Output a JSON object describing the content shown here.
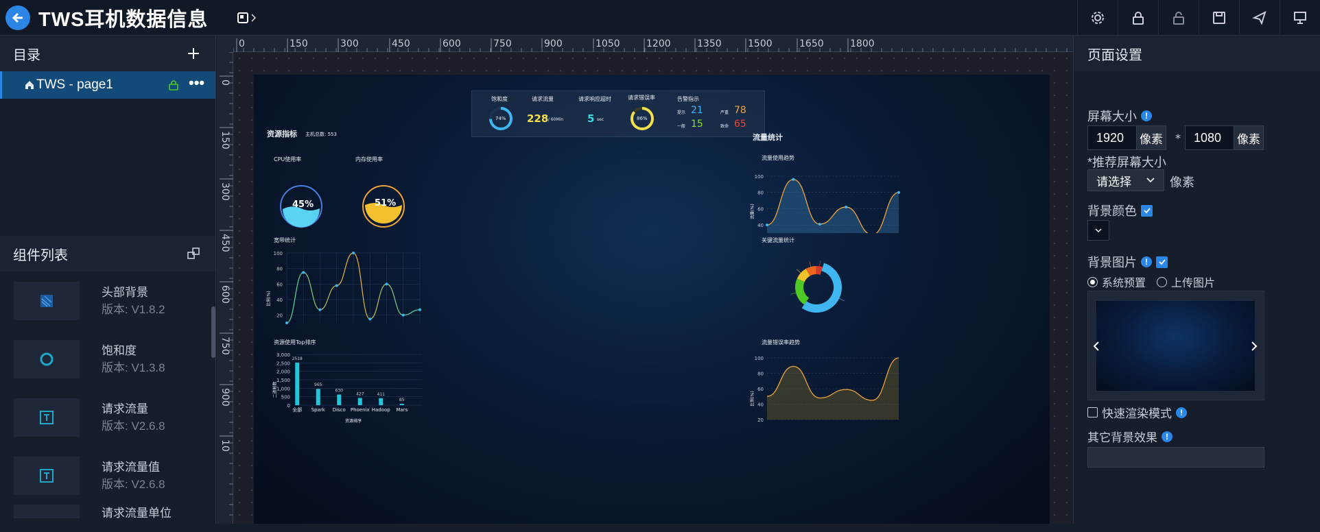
{
  "app": {
    "title": "TWS耳机数据信息"
  },
  "left": {
    "catalog_title": "目录",
    "page_name": "TWS - page1",
    "components_title": "组件列表",
    "components": [
      {
        "name": "头部背景",
        "version": "版本: V1.8.2"
      },
      {
        "name": "饱和度",
        "version": "版本: V1.3.8"
      },
      {
        "name": "请求流量",
        "version": "版本: V2.6.8"
      },
      {
        "name": "请求流量值",
        "version": "版本: V2.6.8"
      },
      {
        "name": "请求流量单位",
        "version": ""
      }
    ]
  },
  "ruler": {
    "h": [
      "0",
      "150",
      "300",
      "450",
      "600",
      "750",
      "900",
      "1050",
      "1200",
      "1350",
      "1500",
      "1650",
      "1800"
    ],
    "v": [
      "0",
      "150",
      "300",
      "450",
      "600",
      "750",
      "900",
      "10"
    ]
  },
  "dash": {
    "kpi": {
      "saturation_label": "饱和度",
      "saturation_value": "74%",
      "flow_label": "请求流量",
      "flow_value": "228",
      "flow_unit": "/ 60Min",
      "timeout_label": "请求响应超时",
      "timeout_value": "5",
      "timeout_unit": "sec",
      "error_label": "请求错误率",
      "error_value": "86%",
      "alarm_label": "告警指示",
      "alarm": [
        {
          "label": "提示",
          "value": "21"
        },
        {
          "label": "严重",
          "value": "78"
        },
        {
          "label": "一般",
          "value": "15"
        },
        {
          "label": "致命",
          "value": "65"
        }
      ]
    },
    "resource_title": "资源指标",
    "host_total": "主机总数: 553",
    "cpu_title": "CPU使用率",
    "cpu_value": "45%",
    "mem_title": "内存使用率",
    "mem_value": "51%",
    "bandwidth_title": "宽带统计",
    "bandwidth_ylabel": "比例(%)",
    "top_title": "资源使用Top排序",
    "top_ylabel": "二进制数",
    "top_xlabel": "资源排序",
    "flow_stat_title": "流量统计",
    "flow_trend_title": "流量使用趋势",
    "flow_trend_ylabel": "流量(%)",
    "key_flow_title": "关键流量统计",
    "error_trend_title": "流量错误率趋势",
    "error_trend_ylabel": "比例(%)"
  },
  "chart_data": [
    {
      "type": "line",
      "title": "宽带统计",
      "ylabel": "比例(%)",
      "yticks": [
        "100",
        "80",
        "60",
        "40",
        "20"
      ],
      "ylim": [
        10,
        100
      ],
      "series": [
        {
          "values": [
            10,
            75,
            27,
            58,
            100,
            15,
            60,
            20,
            27
          ]
        }
      ]
    },
    {
      "type": "bar",
      "title": "资源使用Top排序",
      "ylabel": "二进制数",
      "xlabel": "资源排序",
      "categories": [
        "全部",
        "Spark",
        "Disco",
        "Phoenix",
        "Hadoop",
        "Mars"
      ],
      "values": [
        2518,
        965,
        630,
        427,
        411,
        85
      ],
      "yticks": [
        "3,000",
        "2,500",
        "2,000",
        "1,500",
        "1,000",
        "500",
        "0"
      ],
      "ylim": [
        0,
        3000
      ]
    },
    {
      "type": "area",
      "title": "流量使用趋势",
      "ylabel": "流量(%)",
      "yticks": [
        "100",
        "80",
        "60",
        "40"
      ],
      "ylim": [
        30,
        100
      ],
      "series": [
        {
          "values": [
            40,
            96,
            41,
            62,
            28,
            80
          ]
        }
      ]
    },
    {
      "type": "pie",
      "title": "关键流量统计",
      "series": [
        {
          "values": [
            55,
            22,
            10,
            8,
            5
          ]
        }
      ],
      "colors": [
        "#3fb6f0",
        "#4ec926",
        "#f0c22e",
        "#f2651f",
        "#d23a2f"
      ]
    },
    {
      "type": "area",
      "title": "流量错误率趋势",
      "ylabel": "比例(%)",
      "yticks": [
        "100",
        "80",
        "60",
        "40",
        "20"
      ],
      "ylim": [
        20,
        100
      ],
      "series": [
        {
          "values": [
            50,
            89,
            48,
            59,
            45,
            100
          ]
        }
      ]
    }
  ],
  "right": {
    "title": "页面设置",
    "screen_size_label": "屏幕大小",
    "width": "1920",
    "height": "1080",
    "unit": "像素",
    "times": "*",
    "recommend_label": "*推荐屏幕大小",
    "select_placeholder": "请选择",
    "bgcolor_label": "背景颜色",
    "bgimage_label": "背景图片",
    "radio_preset": "系统预置",
    "radio_upload": "上传图片",
    "fast_render_label": "快速渲染模式",
    "other_bg_label": "其它背景效果"
  }
}
